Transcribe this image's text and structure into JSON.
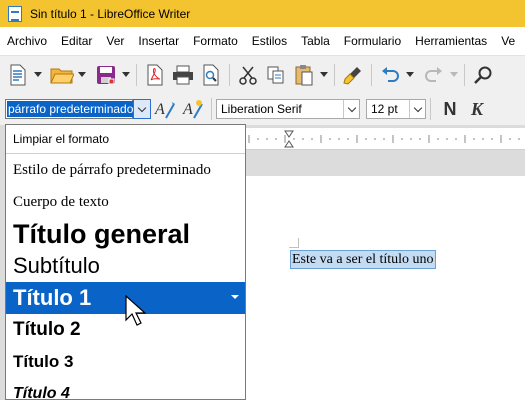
{
  "window": {
    "title": "Sin título 1 - LibreOffice Writer"
  },
  "menubar": [
    "Archivo",
    "Editar",
    "Ver",
    "Insertar",
    "Formato",
    "Estilos",
    "Tabla",
    "Formulario",
    "Herramientas",
    "Ve"
  ],
  "toolbar_icons": [
    "new-document-icon",
    "open-folder-icon",
    "save-icon",
    "export-pdf-icon",
    "print-icon",
    "print-preview-icon",
    "cut-icon",
    "copy-icon",
    "paste-icon",
    "clone-formatting-icon",
    "undo-icon",
    "redo-icon",
    "find-icon"
  ],
  "format_toolbar": {
    "paragraph_style": "párrafo predeterminado",
    "font_name": "Liberation Serif",
    "font_size": "12 pt",
    "bold_label": "N",
    "italic_label": "K"
  },
  "style_dropdown": {
    "clear_label": "Limpiar el formato",
    "items": [
      {
        "label": "Estilo de párrafo predeterminado",
        "selected": false
      },
      {
        "label": "Cuerpo de texto",
        "selected": false
      },
      {
        "label": "Título general",
        "selected": false
      },
      {
        "label": "Subtítulo",
        "selected": false
      },
      {
        "label": "Título 1",
        "selected": true
      },
      {
        "label": "Título 2",
        "selected": false
      },
      {
        "label": "Título 3",
        "selected": false
      },
      {
        "label": "Título 4",
        "selected": false
      }
    ]
  },
  "document": {
    "selected_text": "Este va a ser el título uno"
  },
  "colors": {
    "titlebar": "#f4c430",
    "selection": "#0a64c8",
    "text_highlight": "#c4dcf3"
  }
}
